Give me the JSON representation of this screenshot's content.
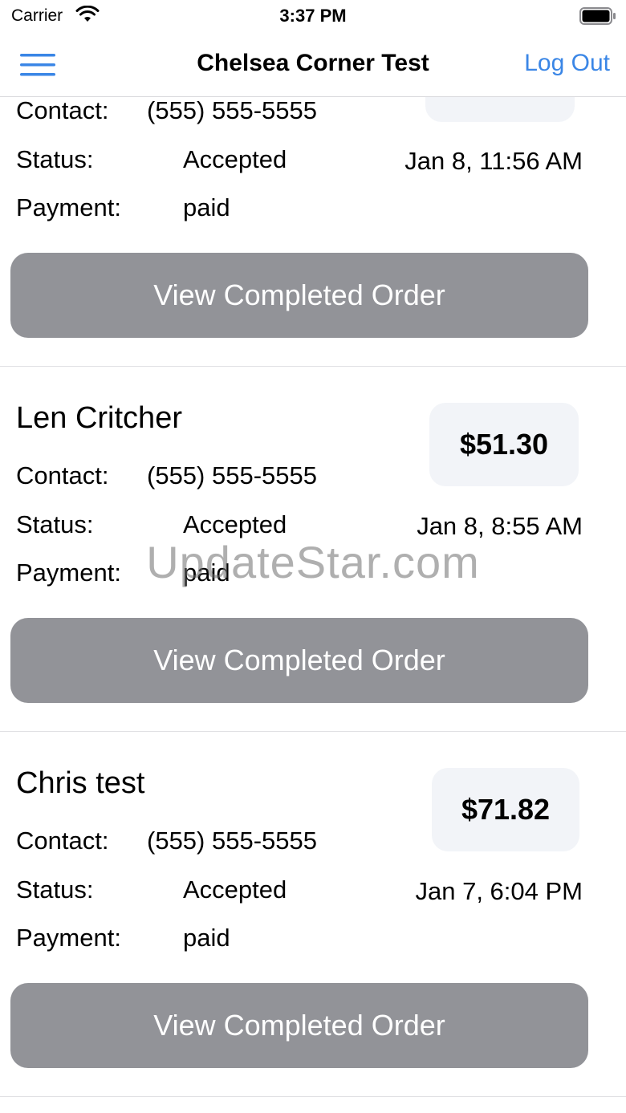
{
  "status_bar": {
    "carrier": "Carrier",
    "time": "3:37 PM"
  },
  "nav": {
    "title": "Chelsea Corner Test",
    "logout_label": "Log Out",
    "accent_color": "#3a86e6"
  },
  "labels": {
    "contact": "Contact:",
    "status": "Status:",
    "payment": "Payment:"
  },
  "orders": [
    {
      "name": "",
      "total": "",
      "contact": "(555) 555-5555",
      "status": "Accepted",
      "date": "Jan 8, 11:56 AM",
      "payment": "paid",
      "button_label": "View Completed Order"
    },
    {
      "name": "Len Critcher",
      "total": "$51.30",
      "contact": "(555) 555-5555",
      "status": "Accepted",
      "date": "Jan 8, 8:55 AM",
      "payment": "paid",
      "button_label": "View Completed Order"
    },
    {
      "name": "Chris test",
      "total": "$71.82",
      "contact": "(555) 555-5555",
      "status": "Accepted",
      "date": "Jan 7, 6:04 PM",
      "payment": "paid",
      "button_label": "View Completed Order"
    }
  ],
  "watermark": "UpdateStar.com"
}
